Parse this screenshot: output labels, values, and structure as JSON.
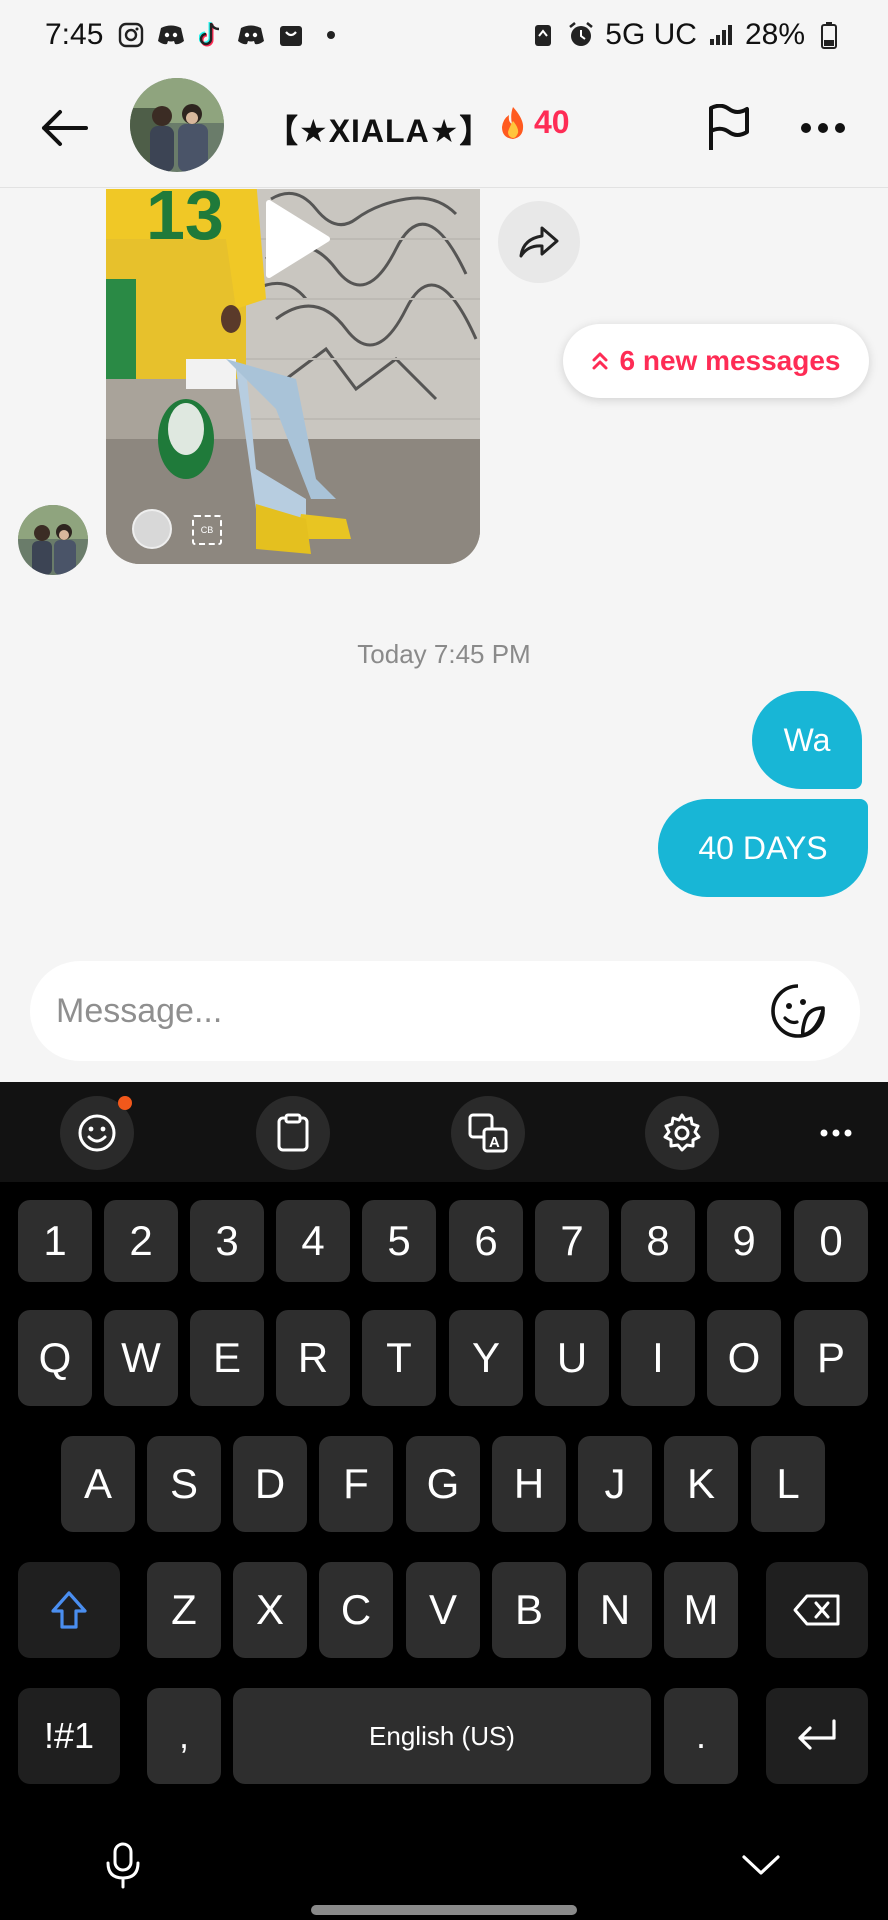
{
  "status_bar": {
    "time": "7:45",
    "network": "5G UC",
    "battery": "28%",
    "icons": [
      "instagram-icon",
      "discord-icon",
      "tiktok-icon",
      "discord-icon",
      "shopping-bag-icon",
      "dot-icon",
      "battery-saver-icon",
      "alarm-icon",
      "signal-icon",
      "battery-icon"
    ]
  },
  "header": {
    "title": "【★XIALA★】",
    "streak": "40"
  },
  "chat": {
    "new_messages": "6 new messages",
    "timestamp": "Today 7:45 PM",
    "messages": [
      {
        "sender": "me",
        "text": "Wa"
      },
      {
        "sender": "me",
        "text": "40 DAYS"
      }
    ],
    "video_card_badge": "CB"
  },
  "composer": {
    "placeholder": "Message..."
  },
  "keyboard": {
    "number_row": [
      "1",
      "2",
      "3",
      "4",
      "5",
      "6",
      "7",
      "8",
      "9",
      "0"
    ],
    "row1": [
      "Q",
      "W",
      "E",
      "R",
      "T",
      "Y",
      "U",
      "I",
      "O",
      "P"
    ],
    "row2": [
      "A",
      "S",
      "D",
      "F",
      "G",
      "H",
      "J",
      "K",
      "L"
    ],
    "row3": [
      "Z",
      "X",
      "C",
      "V",
      "B",
      "N",
      "M"
    ],
    "symbols": "!#1",
    "comma": ",",
    "space": "English (US)",
    "period": "."
  },
  "colors": {
    "accent": "#fe2c55",
    "bubble": "#18b6d6",
    "background": "#f5f5f5",
    "keyboard": "#000000",
    "key": "#2e2e2e"
  }
}
